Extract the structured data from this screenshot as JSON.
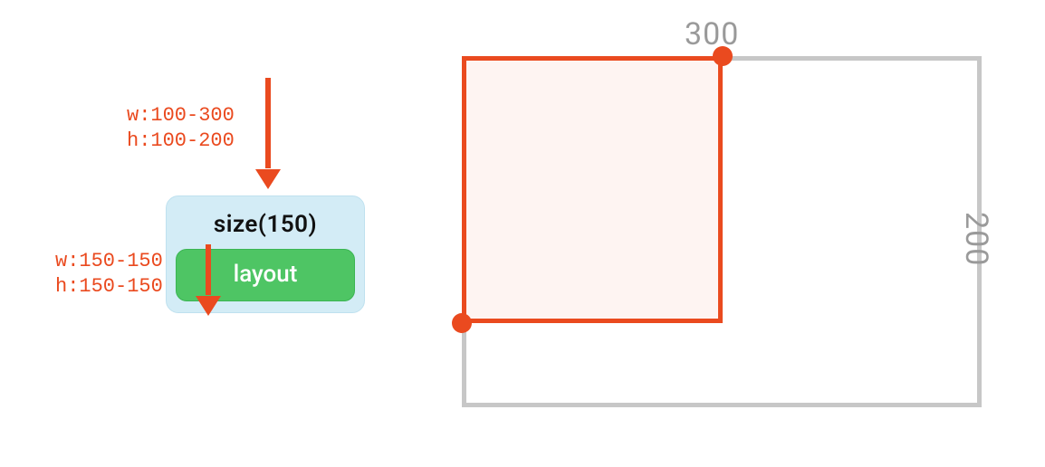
{
  "constraints_in": {
    "w": "w:100-300",
    "h": "h:100-200"
  },
  "constraints_out": {
    "w": "w:150-150",
    "h": "h:150-150"
  },
  "node": {
    "title": "size(150)",
    "child_label": "layout"
  },
  "box": {
    "max_w_label": "300",
    "max_h_label": "200"
  },
  "colors": {
    "accent": "#ea4a1f",
    "card_bg": "#d3ecf6",
    "child_bg": "#4ec564",
    "dim": "#9a9a9a"
  }
}
